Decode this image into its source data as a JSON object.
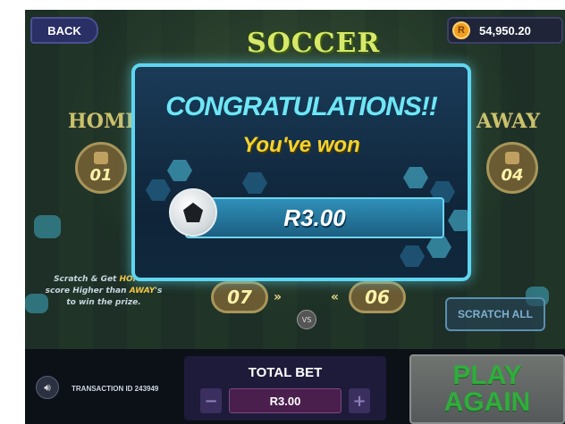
{
  "header": {
    "back_label": "BACK",
    "balance": "54,950.20",
    "coin_symbol": "R",
    "logo_text": "SOCCER"
  },
  "teams": {
    "home_label": "HOME",
    "home_score": "01",
    "away_label": "AWAY",
    "away_score": "04"
  },
  "board": {
    "left_score": "07",
    "right_score": "06",
    "left_arrow": "»",
    "right_arrow": "«",
    "vs_label": "VS",
    "instructions": {
      "part1": "Scratch & Get ",
      "home": "HOME",
      "part2": "'s score Higher than ",
      "away": "AWAY",
      "part3": "'s to win the prize."
    },
    "scratch_all_label": "SCRATCH ALL"
  },
  "modal": {
    "title": "CONGRATULATIONS!!",
    "subtitle": "You've won",
    "prize": "R3.00"
  },
  "footer": {
    "transaction": "TRANSACTION ID 243949",
    "bet_title": "TOTAL BET",
    "bet_value": "R3.00",
    "minus": "−",
    "plus": "+",
    "play_again_line1": "PLAY",
    "play_again_line2": "AGAIN"
  },
  "colors": {
    "modal_border": "#5fd6f0",
    "title": "#6fe6f5",
    "subtitle": "#f3d330",
    "play_again_text": "#2fae3c"
  }
}
